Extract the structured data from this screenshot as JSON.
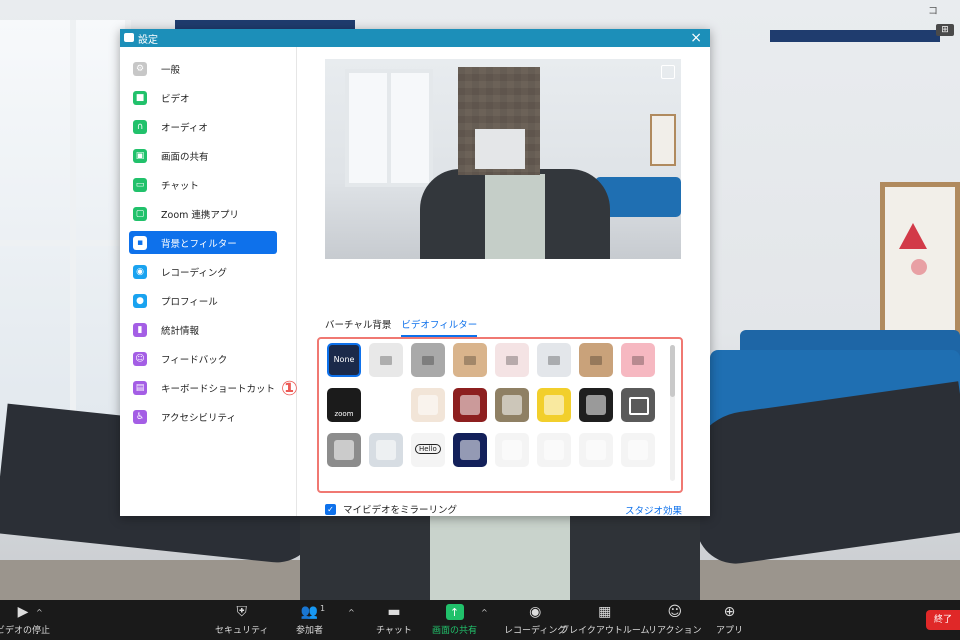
{
  "dialog": {
    "title": "設定",
    "close_glyph": "×"
  },
  "sidebar": {
    "items": [
      {
        "label": "一般",
        "icon": "gear-icon",
        "color": "#c7c7c7"
      },
      {
        "label": "ビデオ",
        "icon": "video-icon",
        "color": "#21c16b"
      },
      {
        "label": "オーディオ",
        "icon": "headphones-icon",
        "color": "#21c16b"
      },
      {
        "label": "画面の共有",
        "icon": "share-screen-icon",
        "color": "#21c16b"
      },
      {
        "label": "チャット",
        "icon": "chat-icon",
        "color": "#21c16b"
      },
      {
        "label": "Zoom 連携アプリ",
        "icon": "apps-icon",
        "color": "#21c16b"
      },
      {
        "label": "背景とフィルター",
        "icon": "background-icon",
        "color": "#0e71eb",
        "active": true
      },
      {
        "label": "レコーディング",
        "icon": "record-icon",
        "color": "#1aa3f0"
      },
      {
        "label": "プロフィール",
        "icon": "profile-icon",
        "color": "#1aa3f0"
      },
      {
        "label": "統計情報",
        "icon": "stats-icon",
        "color": "#a45ee5"
      },
      {
        "label": "フィードバック",
        "icon": "feedback-icon",
        "color": "#a45ee5"
      },
      {
        "label": "キーボードショートカット",
        "icon": "keyboard-icon",
        "color": "#a45ee5"
      },
      {
        "label": "アクセシビリティ",
        "icon": "accessibility-icon",
        "color": "#a45ee5"
      }
    ]
  },
  "tabs": [
    {
      "label": "バーチャル背景",
      "active": false
    },
    {
      "label": "ビデオフィルター",
      "active": true
    }
  ],
  "filters": {
    "none_label": "None",
    "zoom_label": "zoom",
    "items": [
      {
        "name": "none",
        "bg": "#1b2a4a",
        "selected": true
      },
      {
        "name": "white-tint",
        "bg": "#e8e8e8"
      },
      {
        "name": "grey-tint",
        "bg": "#a9a9a9"
      },
      {
        "name": "sepia-tint",
        "bg": "#d9b48c"
      },
      {
        "name": "pink-pale-tint",
        "bg": "#f4e3e4"
      },
      {
        "name": "cool-tint",
        "bg": "#e3e6ea"
      },
      {
        "name": "brown-tint",
        "bg": "#c9a27a"
      },
      {
        "name": "pink-tint",
        "bg": "#f6b8c1"
      },
      {
        "name": "zoom-frame",
        "bg": "#1b1b1b"
      },
      {
        "name": "rainbow-frame",
        "bg": "#ffffff"
      },
      {
        "name": "fox-frame",
        "bg": "#f2e5d8"
      },
      {
        "name": "theater-frame",
        "bg": "#8d1f1f"
      },
      {
        "name": "tv-frame",
        "bg": "#8f8064"
      },
      {
        "name": "sunflower-frame",
        "bg": "#f2cf2c"
      },
      {
        "name": "bulb-frame",
        "bg": "#1f1f1f"
      },
      {
        "name": "focus-frame",
        "bg": "#5a5a5a"
      },
      {
        "name": "retro-tv-frame",
        "bg": "#8c8c8c"
      },
      {
        "name": "award-frame",
        "bg": "#d7dde3"
      },
      {
        "name": "hello-bubble",
        "bg": "#f4f4f4",
        "text": "Hello"
      },
      {
        "name": "lights-frame",
        "bg": "#13205a"
      },
      {
        "name": "sunglasses-sticker",
        "bg": "#f4f4f4"
      },
      {
        "name": "sprout-sticker",
        "bg": "#f4f4f4"
      },
      {
        "name": "rainbow-sticker",
        "bg": "#f4f4f4"
      },
      {
        "name": "party-hat-sticker",
        "bg": "#f4f4f4"
      }
    ]
  },
  "mirror": {
    "label": "マイビデオをミラーリング",
    "checked": true
  },
  "studio_link": "スタジオ効果",
  "annotation": "①",
  "toolbar": {
    "items": [
      {
        "label": "ビデオの停止",
        "icon": "video-camera-icon"
      },
      {
        "label": "セキュリティ",
        "icon": "shield-icon"
      },
      {
        "label": "参加者",
        "icon": "participants-icon",
        "count": "1"
      },
      {
        "label": "チャット",
        "icon": "chat-bubble-icon"
      },
      {
        "label": "画面の共有",
        "icon": "share-arrow-icon"
      },
      {
        "label": "レコーディング",
        "icon": "record-dot-icon"
      },
      {
        "label": "ブレイクアウトルーム",
        "icon": "grid-icon"
      },
      {
        "label": "リアクション",
        "icon": "emoji-icon"
      },
      {
        "label": "アプリ",
        "icon": "apps-plus-icon"
      }
    ],
    "end_label": "終了"
  },
  "colors": {
    "accent": "#0e71eb",
    "titlebar": "#1c8fb9",
    "annotation": "#ec5a55",
    "share_green": "#21c16b",
    "end_red": "#e02828"
  }
}
